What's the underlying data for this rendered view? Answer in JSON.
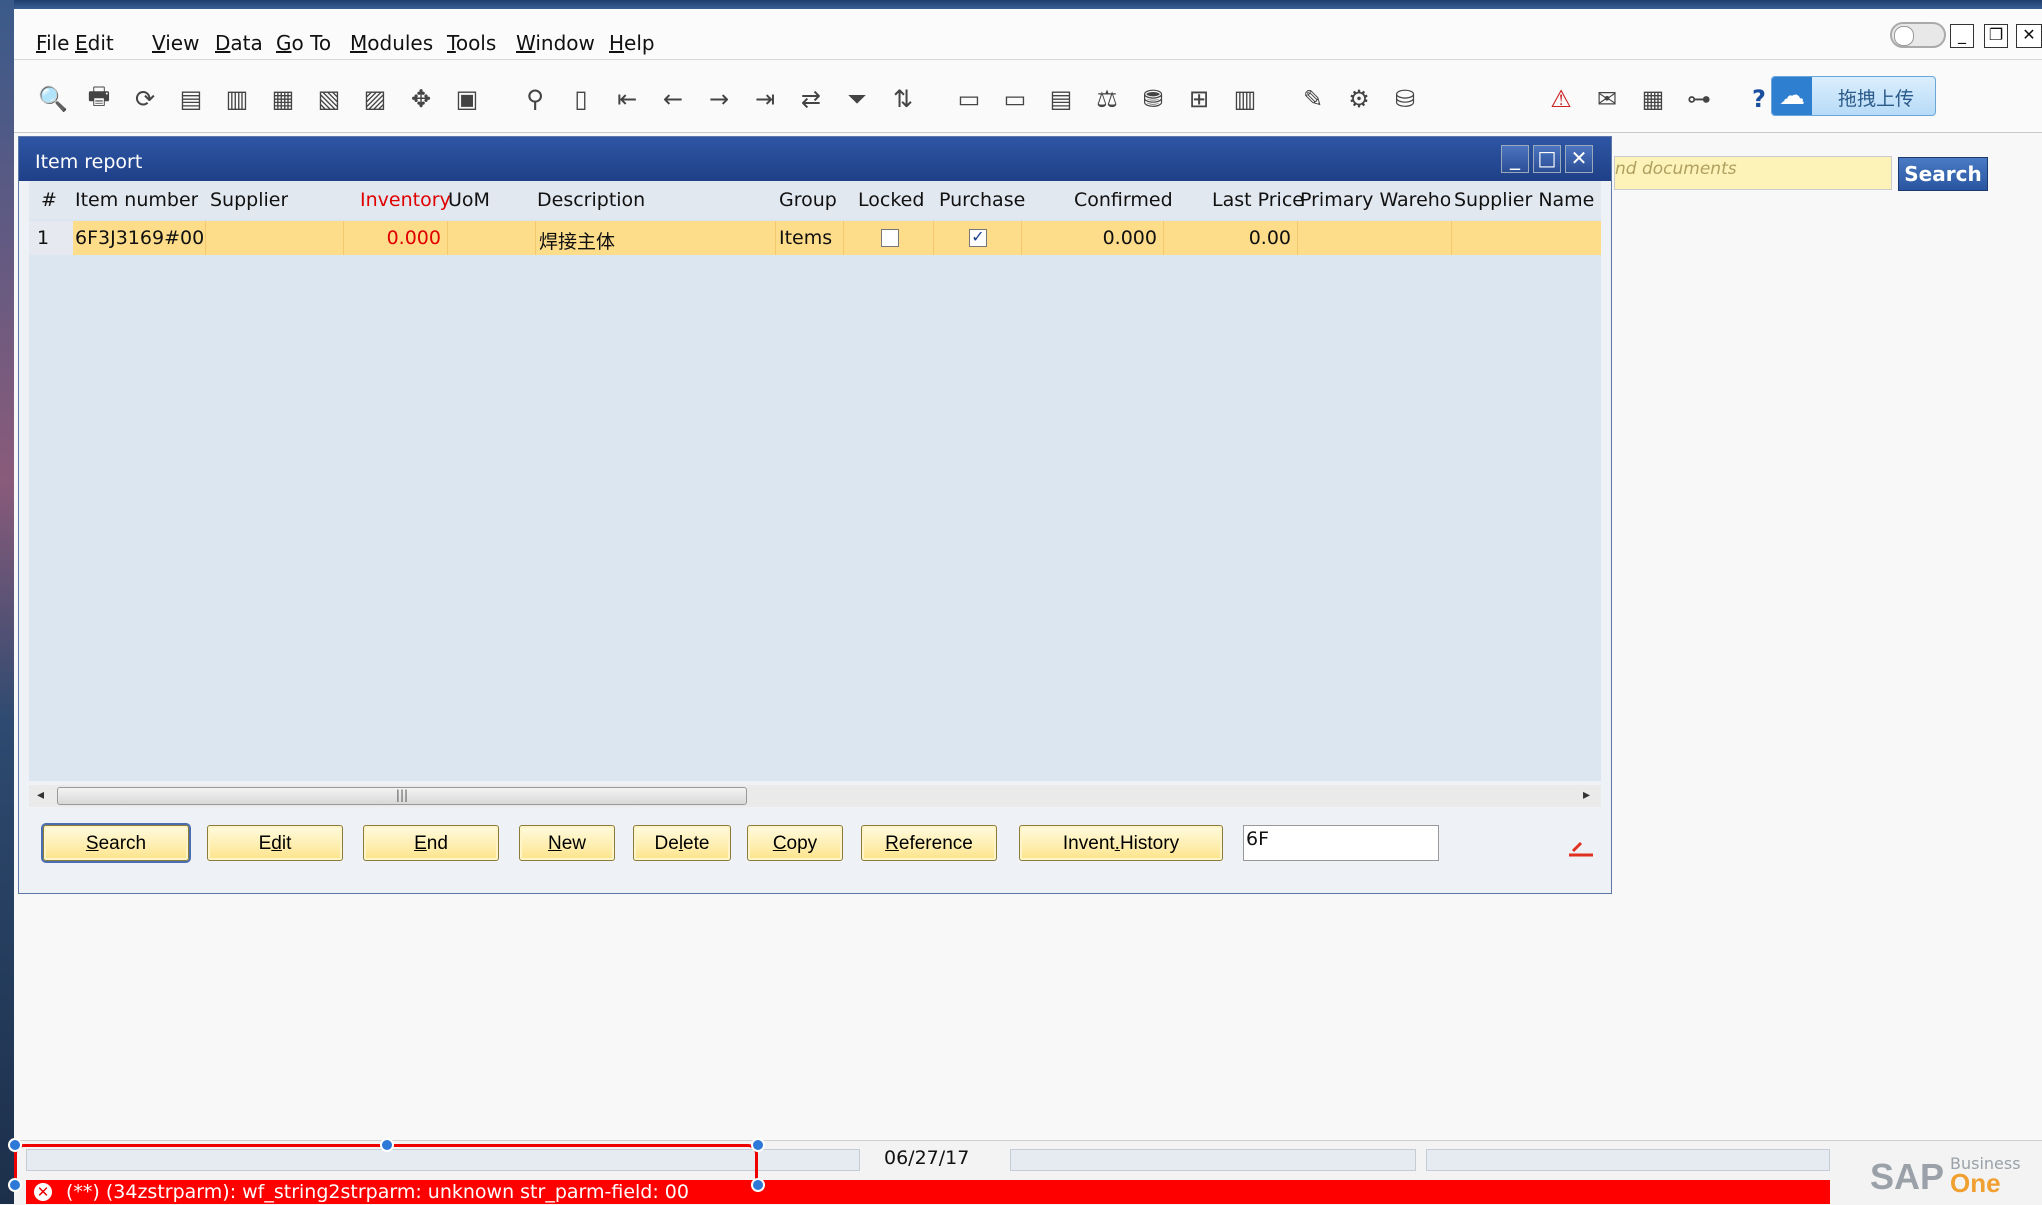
{
  "menu": [
    {
      "pre": "",
      "ul": "F",
      "post": "ile"
    },
    {
      "pre": "",
      "ul": "E",
      "post": "dit"
    },
    {
      "pre": "",
      "ul": "V",
      "post": "iew"
    },
    {
      "pre": "",
      "ul": "D",
      "post": "ata"
    },
    {
      "pre": "",
      "ul": "G",
      "post": "o To"
    },
    {
      "pre": "",
      "ul": "M",
      "post": "odules"
    },
    {
      "pre": "",
      "ul": "T",
      "post": "ools"
    },
    {
      "pre": "",
      "ul": "W",
      "post": "indow"
    },
    {
      "pre": "",
      "ul": "H",
      "post": "elp"
    }
  ],
  "toolbar_icons": [
    "preview-icon",
    "print-icon",
    "refresh-icon",
    "fax-icon",
    "printer2-icon",
    "excel-icon",
    "word-icon",
    "pdf-icon",
    "move-icon",
    "form-settings-icon",
    "find-icon",
    "add-icon",
    "first-record-icon",
    "previous-record-icon",
    "next-record-icon",
    "last-record-icon",
    "refresh-sync-icon",
    "filter-icon",
    "sort-icon",
    "base-document-icon",
    "target-document-icon",
    "gross-profit-icon",
    "volume-weight-icon",
    "money-icon",
    "relationship-map-icon",
    "book-icon",
    "report-icon",
    "edit-icon",
    "settings-icon",
    "database-icon",
    "alert-icon",
    "message-icon",
    "calendar-icon",
    "org-chart-icon",
    "help-icon"
  ],
  "upload": {
    "label": "拖拽上传"
  },
  "find_docs_placeholder": "nd documents",
  "top_search_label": "Search",
  "report": {
    "title": "Item report",
    "columns": [
      "#",
      "Item number",
      "Supplier",
      "Inventory",
      "UoM",
      "Description",
      "Group",
      "Locked",
      "Purchase",
      "Confirmed",
      "Last Price",
      "Primary Warehou",
      "Supplier Name"
    ],
    "rows": [
      {
        "num": "1",
        "item_number": "6F3J3169#00",
        "supplier": "",
        "inventory": "0.000",
        "uom": "",
        "description": "焊接主体",
        "group": "Items",
        "locked": false,
        "purchase": true,
        "confirmed": "0.000",
        "last_price": "0.00",
        "primary_warehouse": "",
        "supplier_name": ""
      }
    ],
    "buttons": [
      {
        "ul": "S",
        "post": "earch",
        "pre": ""
      },
      {
        "pre": "E",
        "ul": "d",
        "post": "it"
      },
      {
        "ul": "E",
        "post": "nd",
        "pre": ""
      },
      {
        "ul": "N",
        "post": "ew",
        "pre": ""
      },
      {
        "pre": "De",
        "ul": "l",
        "post": "ete"
      },
      {
        "ul": "C",
        "post": "opy",
        "pre": ""
      },
      {
        "ul": "R",
        "post": "eference",
        "pre": ""
      },
      {
        "pre": "Invent",
        "ul": ".",
        "post": "History"
      }
    ],
    "filter_value": "6F"
  },
  "status": {
    "date": "06/27/17",
    "error_message": "(**) (34zstrparm): wf_string2strparm: unknown str_parm-field: 00"
  },
  "logo": {
    "sap": "SAP",
    "business": "Business",
    "one": "One"
  },
  "colors": {
    "accent": "#2e56a4",
    "row_highlight": "#fddc8a",
    "error": "#ff0000",
    "header_red": "#e00000"
  }
}
